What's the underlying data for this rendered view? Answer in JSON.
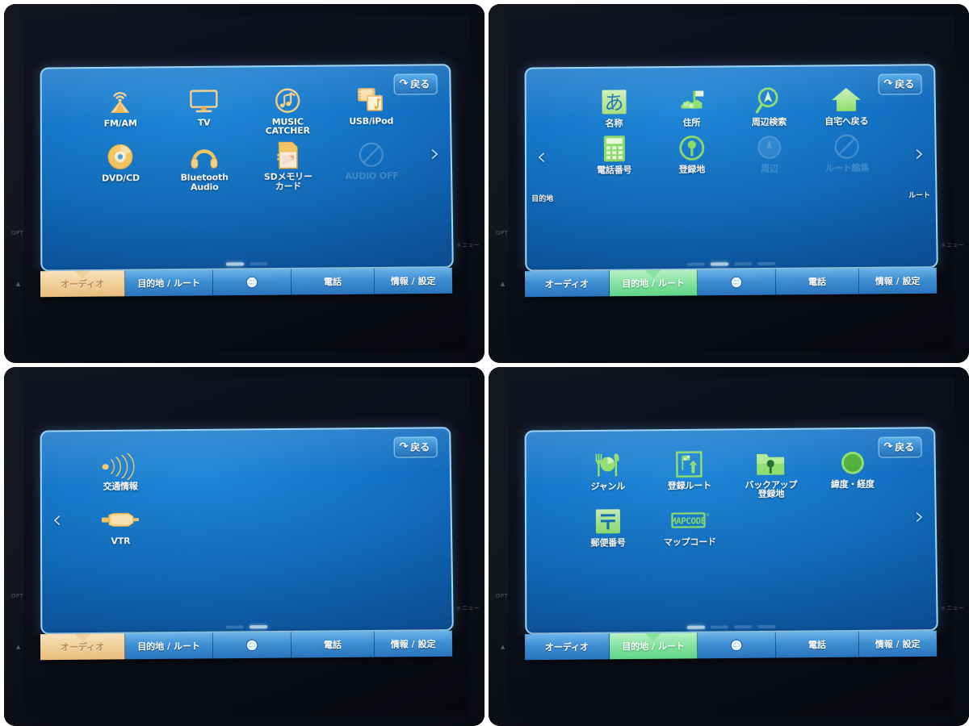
{
  "meta": {
    "device": "car-navigation-head-unit",
    "panel_count": 4
  },
  "common": {
    "back_label": "戻る",
    "back_icon": "undo-arrow-icon",
    "globe_icon": "globe-icon",
    "tabs": [
      {
        "key": "audio",
        "label": "オーディオ"
      },
      {
        "key": "dest",
        "label": "目的地 / ルート"
      },
      {
        "key": "globe",
        "label": "",
        "icon": "globe-icon"
      },
      {
        "key": "phone",
        "label": "電話"
      },
      {
        "key": "info",
        "label": "情報 / 設定"
      }
    ],
    "side_marks": {
      "top_left": "OPT",
      "bottom_left": "▲",
      "right": "メニュー"
    },
    "colors": {
      "screen_blue": "#1472c4",
      "audio_tab_selected": "#f0cf9a",
      "dest_tab_selected": "#86e2a0",
      "icon_orange": "#f5c26b",
      "icon_green": "#8ede6d",
      "label_white": "#ffffff"
    }
  },
  "panels": [
    {
      "id": "panel-audio-page1",
      "selected_tab": "audio",
      "back_label": "戻る",
      "left_chevron": false,
      "right_chevron": true,
      "left_chevron_label": "",
      "right_chevron_label": "",
      "pages": {
        "count": 2,
        "current": 1
      },
      "rows": [
        [
          {
            "label": "FM/AM",
            "icon": "radio-antenna-icon",
            "color": "orange",
            "disabled": false
          },
          {
            "label": "TV",
            "icon": "television-icon",
            "color": "orange",
            "disabled": false
          },
          {
            "label": "MUSIC\nCATCHER",
            "icon": "music-note-circle-icon",
            "color": "orange",
            "disabled": false
          },
          {
            "label": "USB/iPod",
            "icon": "usb-media-icon",
            "color": "orange",
            "disabled": false
          }
        ],
        [
          {
            "label": "DVD/CD",
            "icon": "disc-icon",
            "color": "orange",
            "disabled": false
          },
          {
            "label": "Bluetooth\nAudio",
            "icon": "headphones-icon",
            "color": "orange",
            "disabled": false
          },
          {
            "label": "SDメモリー\nカード",
            "icon": "sd-card-icon",
            "color": "orange",
            "disabled": false
          },
          {
            "label": "AUDIO OFF",
            "icon": "no-entry-slash-icon",
            "color": "dim",
            "disabled": true
          }
        ]
      ]
    },
    {
      "id": "panel-destination-page2",
      "selected_tab": "dest",
      "back_label": "戻る",
      "left_chevron": true,
      "right_chevron": true,
      "left_chevron_label": "目的地",
      "right_chevron_label": "ルート",
      "pages": {
        "count": 4,
        "current": 2
      },
      "rows": [
        [
          {
            "label": "名称",
            "icon": "hiragana-a-icon",
            "color": "green",
            "disabled": false
          },
          {
            "label": "住所",
            "icon": "address-map-icon",
            "color": "green",
            "disabled": false
          },
          {
            "label": "周辺検索",
            "icon": "magnifier-compass-icon",
            "color": "green",
            "disabled": false
          },
          {
            "label": "自宅へ戻る",
            "icon": "home-house-icon",
            "color": "green",
            "disabled": false
          }
        ],
        [
          {
            "label": "電話番号",
            "icon": "telephone-keypad-icon",
            "color": "green",
            "disabled": false
          },
          {
            "label": "登録地",
            "icon": "map-pin-circle-icon",
            "color": "green",
            "disabled": false
          },
          {
            "label": "周辺",
            "icon": "compass-dim-icon",
            "color": "dim",
            "disabled": true
          },
          {
            "label": "ルート編集",
            "icon": "no-entry-slash-icon",
            "color": "dim",
            "disabled": true
          }
        ]
      ]
    },
    {
      "id": "panel-audio-page2",
      "selected_tab": "audio",
      "back_label": "戻る",
      "left_chevron": true,
      "right_chevron": false,
      "left_chevron_label": "",
      "right_chevron_label": "",
      "pages": {
        "count": 2,
        "current": 2
      },
      "rows": [
        [
          {
            "label": "交通情報",
            "icon": "traffic-broadcast-icon",
            "color": "orange",
            "disabled": false
          },
          {
            "label": "",
            "icon": "",
            "color": "",
            "disabled": false,
            "empty": true
          },
          {
            "label": "",
            "icon": "",
            "color": "",
            "disabled": false,
            "empty": true
          },
          {
            "label": "",
            "icon": "",
            "color": "",
            "disabled": false,
            "empty": true
          }
        ],
        [
          {
            "label": "VTR",
            "icon": "rca-plug-icon",
            "color": "orange",
            "disabled": false
          },
          {
            "label": "",
            "icon": "",
            "color": "",
            "disabled": false,
            "empty": true
          },
          {
            "label": "",
            "icon": "",
            "color": "",
            "disabled": false,
            "empty": true
          },
          {
            "label": "",
            "icon": "",
            "color": "",
            "disabled": false,
            "empty": true
          }
        ]
      ]
    },
    {
      "id": "panel-destination-page1",
      "selected_tab": "dest",
      "back_label": "戻る",
      "left_chevron": false,
      "right_chevron": true,
      "left_chevron_label": "",
      "right_chevron_label": "",
      "pages": {
        "count": 4,
        "current": 1
      },
      "rows": [
        [
          {
            "label": "ジャンル",
            "icon": "cutlery-plate-icon",
            "color": "green",
            "disabled": false
          },
          {
            "label": "登録ルート",
            "icon": "route-flag-icon",
            "color": "green",
            "disabled": false
          },
          {
            "label": "バックアップ\n登録地",
            "icon": "folder-pin-icon",
            "color": "green",
            "disabled": false
          },
          {
            "label": "緯度・経度",
            "icon": "compass-green-icon",
            "color": "green",
            "disabled": false
          }
        ],
        [
          {
            "label": "郵便番号",
            "icon": "postal-mark-icon",
            "color": "green",
            "disabled": false
          },
          {
            "label": "マップコード",
            "icon": "mapcode-logo-icon",
            "color": "green",
            "disabled": false,
            "badge": "MAPCODE"
          },
          {
            "label": "",
            "icon": "",
            "color": "",
            "disabled": false,
            "empty": true
          },
          {
            "label": "",
            "icon": "",
            "color": "",
            "disabled": false,
            "empty": true
          }
        ]
      ]
    }
  ]
}
